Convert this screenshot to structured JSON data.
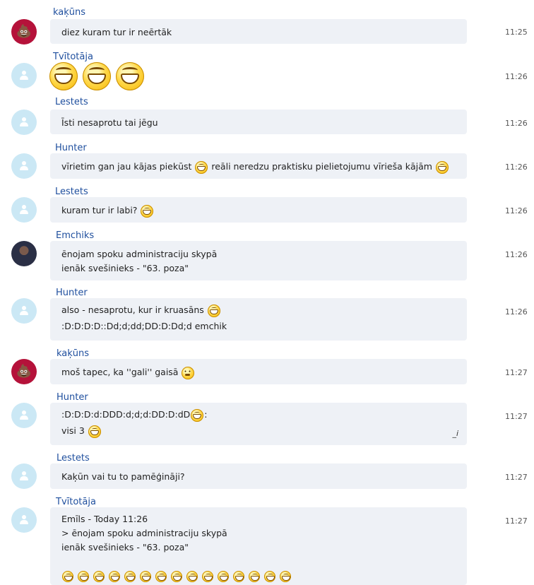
{
  "messages": [
    {
      "author": "kaķūns",
      "avatar": "poop-avatar",
      "time": "11:25",
      "lines": [
        "diez kuram tur ir neērtāk"
      ]
    },
    {
      "author": "Tvītotāja",
      "avatar": "default-avatar",
      "time": "11:26",
      "lines": [
        ""
      ],
      "emoticons": "3 grinning emoticons"
    },
    {
      "author": "Lestets",
      "avatar": "default-avatar",
      "time": "11:26",
      "lines": [
        "Īsti nesaprotu tai jēgu"
      ]
    },
    {
      "author": "Hunter",
      "avatar": "default-avatar",
      "time": "11:26",
      "lines": [
        "vīrietim gan jau kājas piekūst",
        "reāli neredzu praktisku pielietojumu vīrieša kājām"
      ]
    },
    {
      "author": "Lestets",
      "avatar": "default-avatar",
      "time": "11:26",
      "lines": [
        "kuram tur ir labi?"
      ]
    },
    {
      "author": "Emchiks",
      "avatar": "photo-avatar",
      "time": "11:26",
      "lines": [
        "ēnojam spoku administraciju skypā",
        "ienāk svešinieks - \"63. poza\""
      ]
    },
    {
      "author": "Hunter",
      "avatar": "default-avatar",
      "time": "11:26",
      "lines": [
        "also - nesaprotu, kur ir kruasāns",
        ":D:D:D:D::Dd;d;dd;DD:D:Dd;d emchik"
      ]
    },
    {
      "author": "kaķūns",
      "avatar": "poop-avatar",
      "time": "11:27",
      "lines": [
        "moš tapec, ka ''gali'' gaisā"
      ]
    },
    {
      "author": "Hunter",
      "avatar": "default-avatar",
      "time": "11:27",
      "lines": [
        ":D:D:D:d:DDD:d;d;d:DD:D:dD",
        ":",
        "visi 3"
      ],
      "edited_mark": "_i"
    },
    {
      "author": "Lestets",
      "avatar": "default-avatar",
      "time": "11:27",
      "lines": [
        "Kaķūn vai tu to pamēģināji?"
      ]
    },
    {
      "author": "Tvītotāja",
      "avatar": "default-avatar",
      "time": "11:27",
      "lines": [
        "Emīls - Today 11:26",
        "> ēnojam spoku administraciju skypā",
        "ienāk svešinieks - \"63. poza\""
      ]
    }
  ]
}
